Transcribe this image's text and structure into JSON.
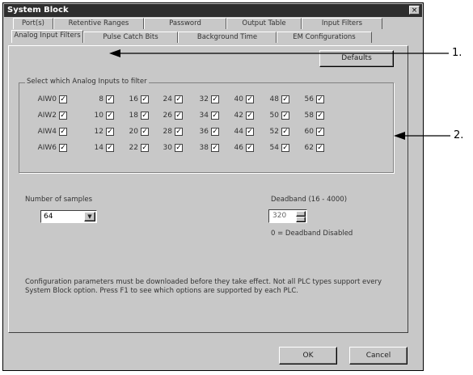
{
  "window": {
    "title": "System Block",
    "close_glyph": "×"
  },
  "tabs_back": [
    "Port(s)",
    "Retentive Ranges",
    "Password",
    "Output Table",
    "Input Filters"
  ],
  "tabs_front": [
    "Analog Input Filters",
    "Pulse Catch Bits",
    "Background Time",
    "EM Configurations"
  ],
  "defaults_button": "Defaults",
  "group_label": "Select which Analog Inputs to filter",
  "check_glyph": "✓",
  "filter_grid": [
    [
      "AIW0",
      "8",
      "16",
      "24",
      "32",
      "40",
      "48",
      "56"
    ],
    [
      "AIW2",
      "10",
      "18",
      "26",
      "34",
      "42",
      "50",
      "58"
    ],
    [
      "AIW4",
      "12",
      "20",
      "28",
      "36",
      "44",
      "52",
      "60"
    ],
    [
      "AIW6",
      "14",
      "22",
      "30",
      "38",
      "46",
      "54",
      "62"
    ]
  ],
  "samples": {
    "label": "Number of samples",
    "value": "64",
    "dropdown_glyph": "▼"
  },
  "deadband": {
    "label": "Deadband (16 - 4000)",
    "value": "320",
    "note": "0 = Deadband Disabled"
  },
  "info_text": "Configuration parameters must be downloaded before they take effect. Not all PLC types support every System Block option.  Press F1 to see which options are supported by each PLC.",
  "ok_button": "OK",
  "cancel_button": "Cancel",
  "callouts": [
    "1.",
    "2."
  ]
}
